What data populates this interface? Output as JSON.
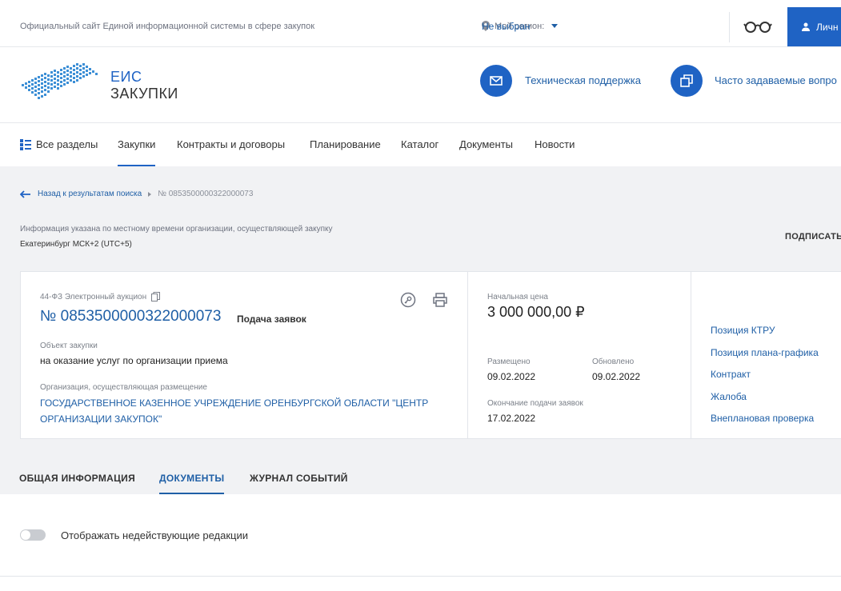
{
  "topbar": {
    "official_text": "Официальный сайт Единой информационной системы в сфере закупок",
    "region_label": "Мой регион:",
    "region_value": "Не выбран",
    "login_label": "Личн"
  },
  "header": {
    "logo_line1": "ЕИС",
    "logo_line2": "ЗАКУПКИ",
    "support_label": "Техническая поддержка",
    "faq_label": "Часто задаваемые вопро"
  },
  "nav": {
    "items": [
      "Все разделы",
      "Закупки",
      "Контракты и договоры",
      "Планирование",
      "Каталог",
      "Документы",
      "Новости"
    ]
  },
  "breadcrumb": {
    "back_label": "Назад к результатам поиска",
    "current": "№ 0853500000322000073"
  },
  "time_info": {
    "note": "Информация указана по местному времени организации, осуществляющей закупку",
    "zone": "Екатеринбург МСК+2 (UTC+5)"
  },
  "subscribe_label": "ПОДПИСАТЬ",
  "card": {
    "type": "44-ФЗ Электронный аукцион",
    "number": "№ 0853500000322000073",
    "stage": "Подача заявок",
    "object_label": "Объект закупки",
    "object_value": "на оказание услуг по организации приема",
    "org_label": "Организация, осуществляющая размещение",
    "org_value": "ГОСУДАРСТВЕННОЕ КАЗЕННОЕ УЧРЕЖДЕНИЕ ОРЕНБУРГСКОЙ ОБЛАСТИ \"ЦЕНТР ОРГАНИЗАЦИИ ЗАКУПОК\"",
    "price_label": "Начальная цена",
    "price_value": "3 000 000,00 ₽",
    "posted_label": "Размещено",
    "posted_value": "09.02.2022",
    "updated_label": "Обновлено",
    "updated_value": "09.02.2022",
    "deadline_label": "Окончание подачи заявок",
    "deadline_value": "17.02.2022",
    "links": [
      "Позиция КТРУ",
      "Позиция плана-графика",
      "Контракт",
      "Жалоба",
      "Внеплановая проверка"
    ]
  },
  "tabs": [
    "ОБЩАЯ ИНФОРМАЦИЯ",
    "ДОКУМЕНТЫ",
    "ЖУРНАЛ СОБЫТИЙ"
  ],
  "toggle_label": "Отображать недействующие редакции",
  "colors": {
    "accent": "#1f63c4",
    "link": "#1f5fa6",
    "gray_bg": "#f1f2f4"
  }
}
